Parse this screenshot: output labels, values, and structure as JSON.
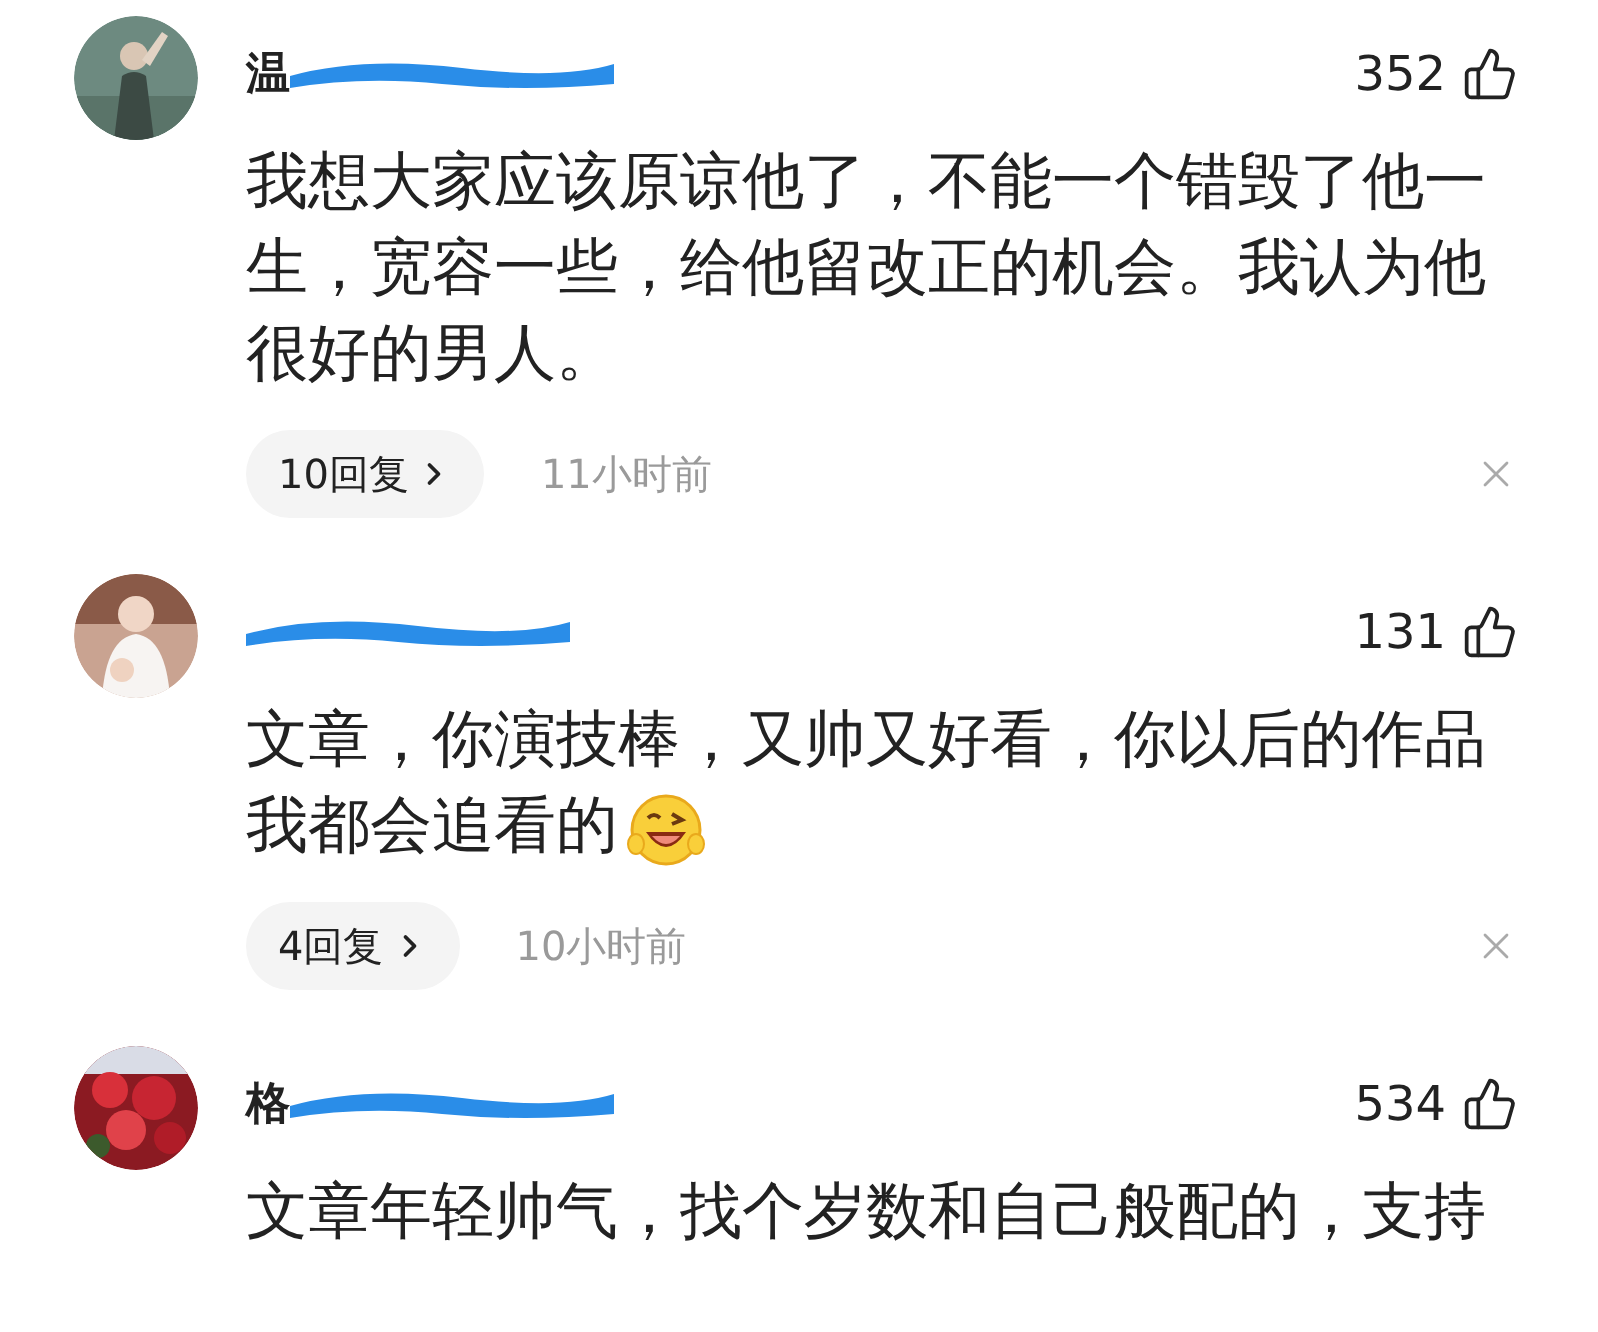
{
  "comments": [
    {
      "name": "温",
      "likes": "352",
      "text": "我想大家应该原谅他了，不能一个错毁了他一生，宽容一些，给他留改正的机会。我认为他很好的男人。",
      "replies": "10回复",
      "time": "11小时前"
    },
    {
      "likes": "131",
      "text": "文章，你演技棒，又帅又好看，你以后的作品我都会追看的",
      "emoji": true,
      "replies": "4回复",
      "time": "10小时前"
    },
    {
      "name": "格",
      "likes": "534",
      "text": "文章年轻帅气，找个岁数和自己般配的，支持"
    }
  ]
}
